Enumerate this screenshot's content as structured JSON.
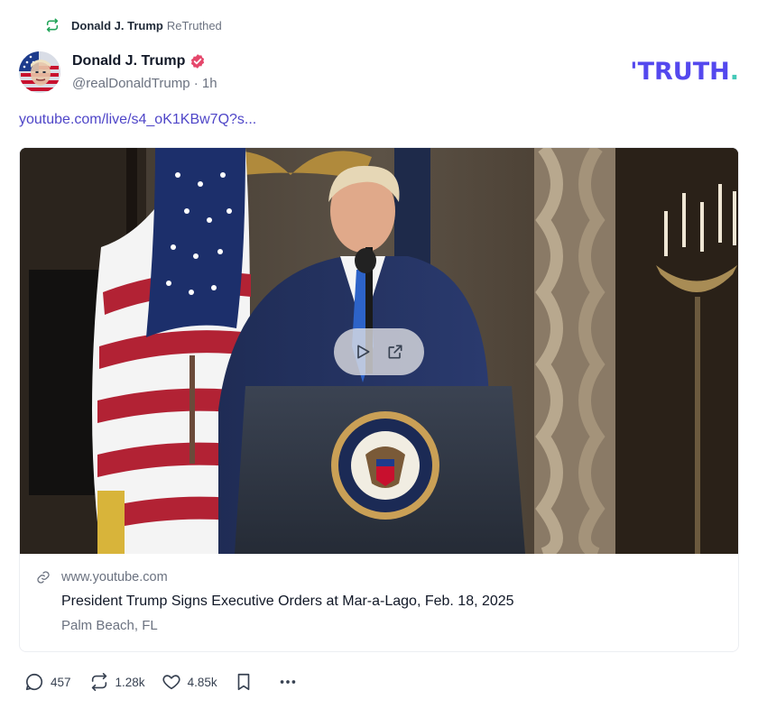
{
  "retruth": {
    "name": "Donald J. Trump",
    "label": "ReTruthed"
  },
  "author": {
    "display_name": "Donald J. Trump",
    "handle": "@realDonaldTrump",
    "separator": "·",
    "time": "1h",
    "verified": true
  },
  "brand": {
    "text": "TRUTH",
    "dot": ".",
    "color_primary": "#5448ee",
    "color_accent": "#45c9b8"
  },
  "post": {
    "link_text": "youtube.com/live/s4_oK1KBw7Q?s..."
  },
  "card": {
    "domain": "www.youtube.com",
    "title": "President Trump Signs Executive Orders at Mar-a-Lago, Feb. 18, 2025",
    "description": "Palm Beach, FL"
  },
  "actions": {
    "replies": "457",
    "retruths": "1.28k",
    "likes": "4.85k"
  },
  "icons": [
    "retruth-icon",
    "verified-badge-icon",
    "play-icon",
    "external-link-icon",
    "link-icon",
    "reply-icon",
    "like-icon",
    "bookmark-icon",
    "more-icon"
  ]
}
